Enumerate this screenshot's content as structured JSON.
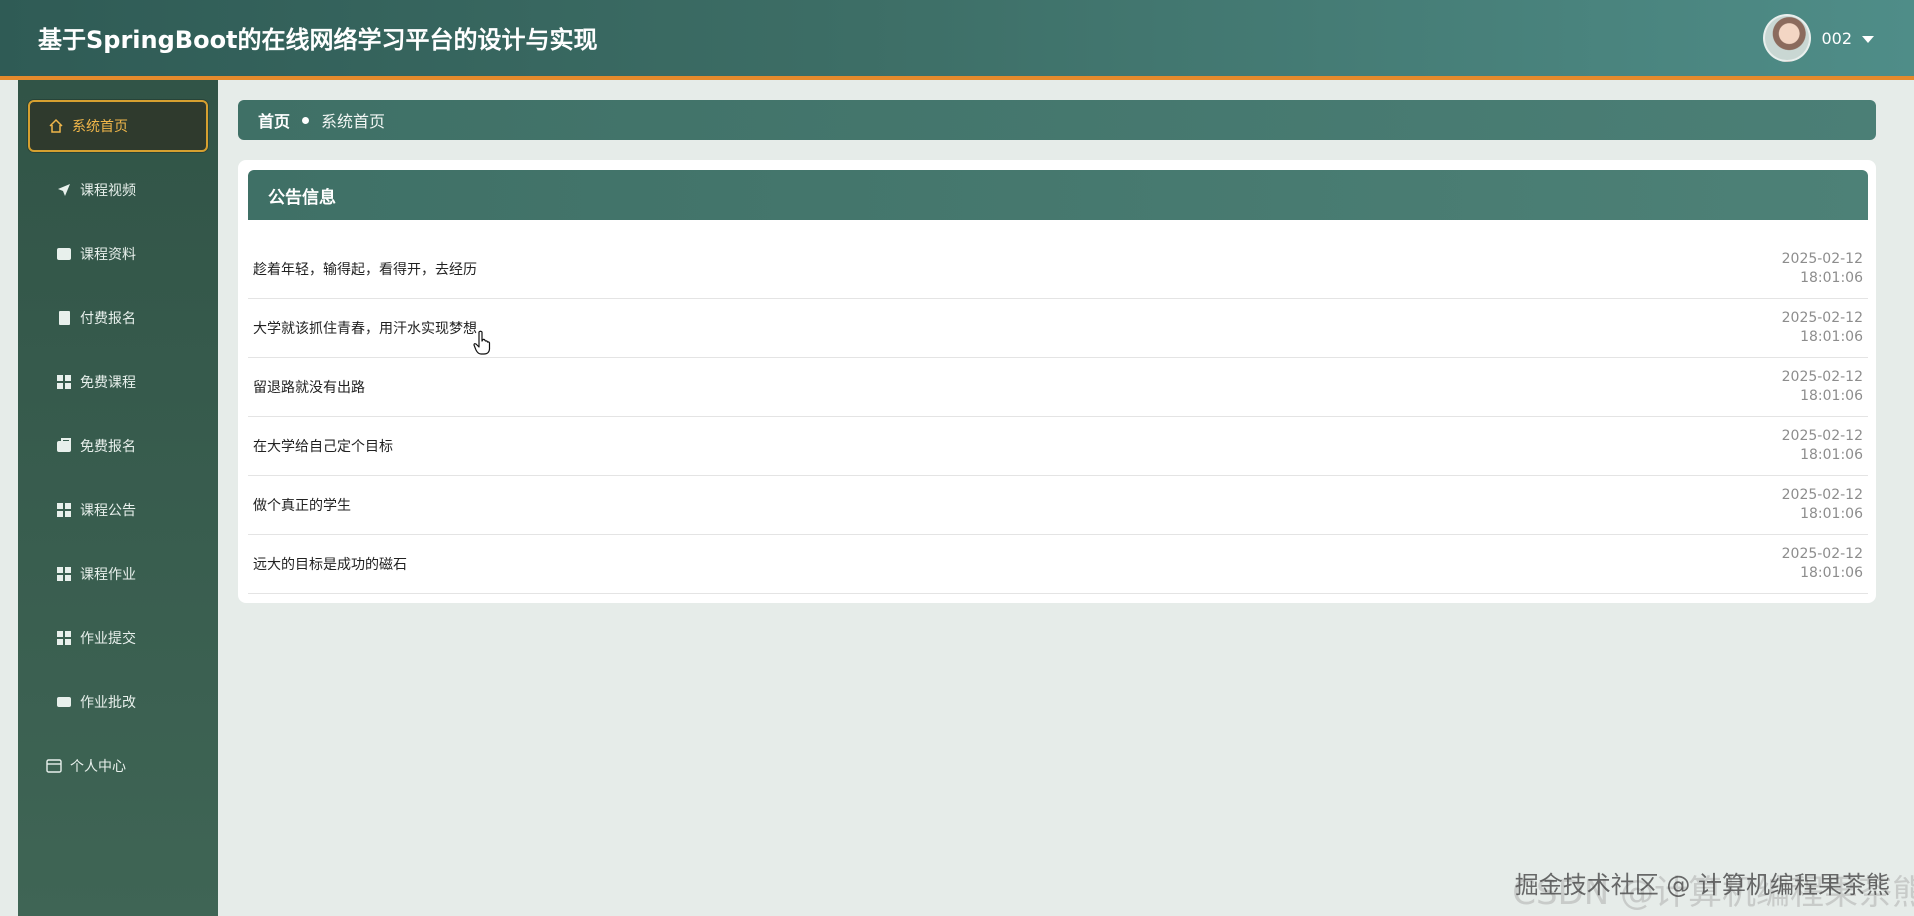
{
  "header": {
    "title": "基于SpringBoot的在线网络学习平台的设计与实现",
    "user_name": "002"
  },
  "sidebar": {
    "items": [
      {
        "label": "系统首页",
        "icon": "home-icon",
        "active": true
      },
      {
        "label": "课程视频",
        "icon": "send-icon"
      },
      {
        "label": "课程资料",
        "icon": "wallet-icon"
      },
      {
        "label": "付费报名",
        "icon": "clipboard-icon"
      },
      {
        "label": "免费课程",
        "icon": "grid-icon"
      },
      {
        "label": "免费报名",
        "icon": "briefcase-icon"
      },
      {
        "label": "课程公告",
        "icon": "grid-icon"
      },
      {
        "label": "课程作业",
        "icon": "grid-icon"
      },
      {
        "label": "作业提交",
        "icon": "grid-icon"
      },
      {
        "label": "作业批改",
        "icon": "printer-icon"
      },
      {
        "label": "个人中心",
        "icon": "card-icon"
      }
    ]
  },
  "breadcrumb": {
    "home": "首页",
    "current": "系统首页"
  },
  "notice": {
    "title": "公告信息",
    "items": [
      {
        "title": "趁着年轻，输得起，看得开，去经历",
        "date": "2025-02-12",
        "time": "18:01:06"
      },
      {
        "title": "大学就该抓住青春，用汗水实现梦想",
        "date": "2025-02-12",
        "time": "18:01:06"
      },
      {
        "title": "留退路就没有出路",
        "date": "2025-02-12",
        "time": "18:01:06"
      },
      {
        "title": "在大学给自己定个目标",
        "date": "2025-02-12",
        "time": "18:01:06"
      },
      {
        "title": "做个真正的学生",
        "date": "2025-02-12",
        "time": "18:01:06"
      },
      {
        "title": "远大的目标是成功的磁石",
        "date": "2025-02-12",
        "time": "18:01:06"
      }
    ]
  },
  "watermark": {
    "text": "掘金技术社区 @ 计算机编程果茶熊",
    "text_faded": "CSDN @计算机编程果茶熊"
  },
  "colors": {
    "header_start": "#2f5b55",
    "header_end": "#4f8d88",
    "accent_orange": "#e58a2c",
    "sidebar": "#315447",
    "active_border": "#d6a030",
    "active_text": "#f0b64a"
  }
}
